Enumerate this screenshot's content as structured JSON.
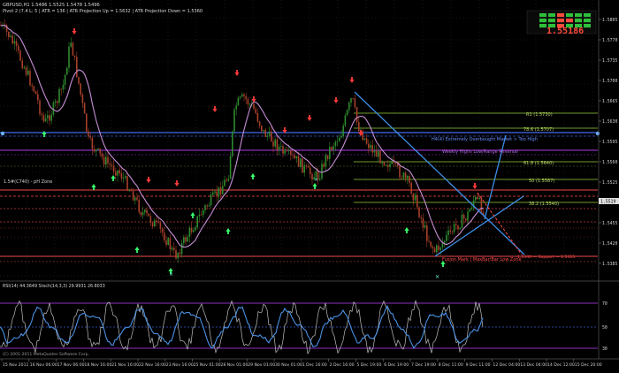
{
  "header": {
    "line1": "GBPUSD,H1 1.5486 1.5525 1.5478 1.5496",
    "line2": "Pivot 2 (7.4 L: 5 | ATR = 136 | ATR Projection Up = 1.5632 | ATR Projection Down = 1.5360"
  },
  "price_box": {
    "value": "1.55186"
  },
  "right_scale": {
    "ticks": [
      "1.5805",
      "1.5770",
      "1.5735",
      "1.5700",
      "1.5665",
      "1.5630",
      "1.5595",
      "1.5560",
      "1.5525",
      "1.5490",
      "1.5455",
      "1.5420",
      "1.5385"
    ],
    "current_price_label": "1.5519"
  },
  "annotations": {
    "fib_100": "R1 (1.5730)",
    "fib_786": "78.6 (1.5707)",
    "fib_618": "61.8 (1.5640)",
    "fib_50": "50 (1.5587)",
    "fib_382": "38.2 (1.5540)",
    "h4_overbought": "H4(4) Extremely Overbought Market > Too High",
    "weekly_highs": "Weekly Highs Low/Range Reversal",
    "bottom_label": "Fusion Mark / MaxBar/Bar Low Zone",
    "pivot_left": "1.5#(C740) - pH Zone",
    "bottom_right_label": "1.5340 — Support — 1.5315"
  },
  "oscillator": {
    "label": "RSI(14) 44.3649  Stoch(14,3,3) 29.9931 26.8033",
    "levels": [
      "70",
      "50",
      "30"
    ]
  },
  "copyright": "(C) 2001-2011 MetaQuotes Software Corp.",
  "x_axis": {
    "ticks": [
      "15 Nov 2011",
      "16 Nov 06:00",
      "17 Nov 06:00",
      "18 Nov 16:00",
      "21 Nov 16:00",
      "22 Nov 16:00",
      "23 Nov 16:00",
      "25 Nov 01:00",
      "28 Nov 01:00",
      "29 Nov 01:00",
      "30 Nov 01:00",
      "1 Dec 16:00",
      "2 Dec 16:00",
      "5 Dec 19:00",
      "6 Dec 19:00",
      "7 Dec 19:00",
      "8 Dec 11:00",
      "9 Dec 11:00",
      "12 Dec 04:00",
      "13 Dec 04:00",
      "14 Dec 12:00",
      "15 Dec 20:00"
    ]
  },
  "colors": {
    "background": "#000000",
    "up_arrow": "#39ff6e",
    "down_arrow": "#ff3a3a",
    "trendline": "#3e8fe8",
    "moving_average": "#c88fd6",
    "rsi_line": "#4a90e2",
    "stoch_line": "#bdbdbd",
    "price_box": "#ff4a3d",
    "level_green": "#6f9a2a",
    "level_red": "#c43a3a",
    "level_purple": "#8b2fbf",
    "level_blue": "#3858c8"
  }
}
